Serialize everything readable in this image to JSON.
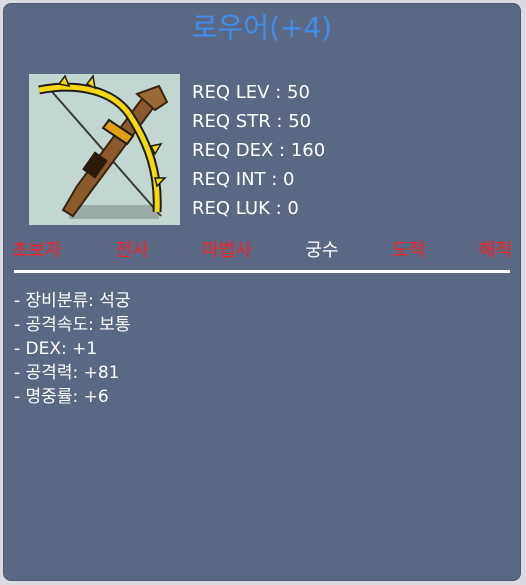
{
  "item": {
    "name": "로우어(+4)",
    "icon": "golden-crossbow-icon"
  },
  "requirements": [
    "REQ LEV : 50",
    "REQ STR : 50",
    "REQ DEX : 160",
    "REQ INT : 0",
    "REQ LUK : 0"
  ],
  "jobs": [
    {
      "label": "초보자",
      "allowed": false
    },
    {
      "label": "전사",
      "allowed": false
    },
    {
      "label": "마법사",
      "allowed": false
    },
    {
      "label": "궁수",
      "allowed": true
    },
    {
      "label": "도적",
      "allowed": false
    },
    {
      "label": "해적",
      "allowed": false
    }
  ],
  "options": [
    "- 장비분류: 석궁",
    "- 공격속도: 보통",
    "- DEX: +1",
    "- 공격력: +81",
    "- 명중률: +6"
  ],
  "colors": {
    "panel": "#5b6884",
    "title": "#3d8ff0",
    "job_disallowed": "#ff1c1c",
    "job_allowed": "#ffffff"
  }
}
